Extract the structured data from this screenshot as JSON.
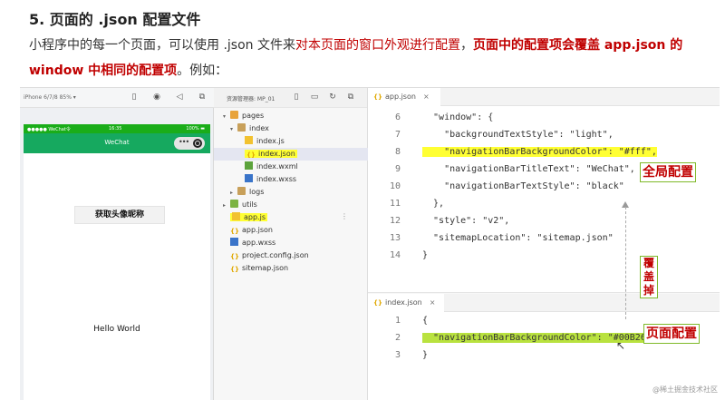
{
  "article": {
    "heading": "5. 页面的 .json 配置文件",
    "para_a": "小程序中的每一个页面，可以使用 .json 文件来",
    "para_b": "对本页面的窗口外观进行配置",
    "para_c": "，",
    "para_d": "页面中的配置项会覆盖 app.json 的 window 中相同的配置项",
    "para_e": "。例如："
  },
  "simulator": {
    "device": "iPhone 6/7/8 85% ▾",
    "status_left": "●●●●● WeChat令",
    "status_time": "16:35",
    "status_right": "100% ▬",
    "nav_title": "WeChat",
    "capsule_dots": "•••",
    "avatar_button": "获取头像昵称",
    "hello": "Hello World"
  },
  "explorer": {
    "title": "资源管理器: MP_01",
    "items": [
      {
        "name": "pages",
        "arrow": "▾"
      },
      {
        "name": "index",
        "arrow": "▾"
      },
      {
        "name": "index.js"
      },
      {
        "name": "index.json"
      },
      {
        "name": "index.wxml"
      },
      {
        "name": "index.wxss"
      },
      {
        "name": "logs",
        "arrow": "▸"
      },
      {
        "name": "utils",
        "arrow": "▸"
      },
      {
        "name": "app.js"
      },
      {
        "name": "app.json"
      },
      {
        "name": "app.wxss"
      },
      {
        "name": "project.config.json"
      },
      {
        "name": "sitemap.json"
      }
    ],
    "more": "⋮"
  },
  "editor_top": {
    "tab": "app.json",
    "tab_icon": "{}",
    "lines": [
      {
        "n": "6",
        "t": "  \"window\": {"
      },
      {
        "n": "7",
        "t": "    \"backgroundTextStyle\": \"light\","
      },
      {
        "n": "8",
        "t": "    \"navigationBarBackgroundColor\": \"#fff\","
      },
      {
        "n": "9",
        "t": "    \"navigationBarTitleText\": \"WeChat\","
      },
      {
        "n": "10",
        "t": "    \"navigationBarTextStyle\": \"black\""
      },
      {
        "n": "11",
        "t": "  },"
      },
      {
        "n": "12",
        "t": "  \"style\": \"v2\","
      },
      {
        "n": "13",
        "t": "  \"sitemapLocation\": \"sitemap.json\""
      },
      {
        "n": "14",
        "t": "}"
      }
    ]
  },
  "editor_bottom": {
    "tab": "index.json",
    "tab_icon": "{}",
    "lines": [
      {
        "n": "1",
        "t": "{"
      },
      {
        "n": "2",
        "t": "  \"navigationBarBackgroundColor\": \"#00B26A\""
      },
      {
        "n": "3",
        "t": "}"
      }
    ]
  },
  "annotations": {
    "global": "全局配置",
    "page": "页面配置",
    "override": "覆盖掉"
  },
  "watermark": "@稀土掘金技术社区",
  "colors": {
    "nav_green": "#16a95f",
    "highlight_yellow": "#ffff33",
    "code_highlight": "#b9e23f",
    "accent_red": "#c00000"
  }
}
